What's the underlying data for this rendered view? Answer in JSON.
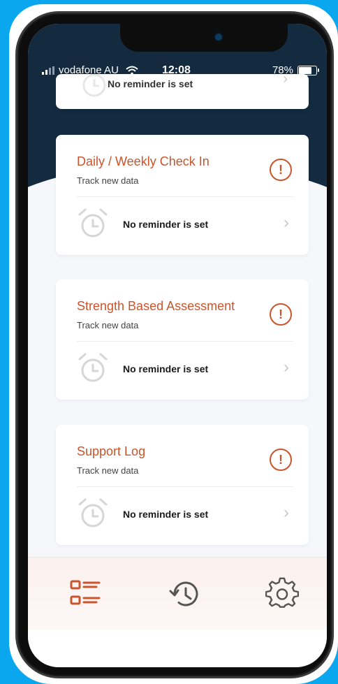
{
  "status_bar": {
    "carrier": "vodafone AU",
    "time": "12:08",
    "battery": "78%",
    "battery_level": 0.78
  },
  "partial_card": {
    "reminder": "No reminder is set"
  },
  "cards": [
    {
      "title": "Daily / Weekly Check In",
      "subtitle": "Track new data",
      "reminder": "No reminder is set"
    },
    {
      "title": "Strength Based Assessment",
      "subtitle": "Track new data",
      "reminder": "No reminder is set"
    },
    {
      "title": "Support Log",
      "subtitle": "Track new data",
      "reminder": "No reminder is set"
    }
  ],
  "icons": {
    "warning": "!",
    "chevron": "›",
    "wifi": "wifi-icon",
    "alarm": "alarm-clock-icon",
    "tab_list": "list-icon",
    "tab_history": "history-icon",
    "tab_settings": "gear-icon"
  },
  "colors": {
    "background": "#0ba7ee",
    "header": "#132a3f",
    "accent": "#c9552d",
    "icon_gray": "#c9c9c9"
  }
}
